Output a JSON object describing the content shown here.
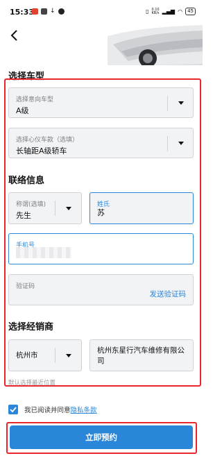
{
  "status_bar": {
    "time": "15:33",
    "speed": "0.10\nKB/s",
    "battery": "45"
  },
  "sections": {
    "vehicle": "选择车型",
    "contact": "联络信息",
    "dealer": "选择经销商"
  },
  "vehicle": {
    "intended_label": "选择意向车型",
    "intended_value": "A级",
    "model_label": "选择心仪车款（选填）",
    "model_value": "长轴距A级轿车"
  },
  "contact": {
    "salutation_label": "称谓(选填)",
    "salutation_value": "先生",
    "surname_label": "姓氏",
    "surname_value": "苏",
    "phone_label": "手机号",
    "code_label": "验证码",
    "send_code": "发送验证码"
  },
  "dealer": {
    "city": "杭州市",
    "name": "杭州东星行汽车维修有限公司",
    "hint": "默认选择最近位置"
  },
  "agreement": {
    "prefix": "我已阅读并同意",
    "link": "隐私条款"
  },
  "submit_label": "立即预约",
  "colors": {
    "accent": "#2a86d8",
    "highlight": "#e8262b"
  },
  "icons": [
    "back-arrow-icon",
    "chevron-down-icon",
    "check-icon"
  ]
}
